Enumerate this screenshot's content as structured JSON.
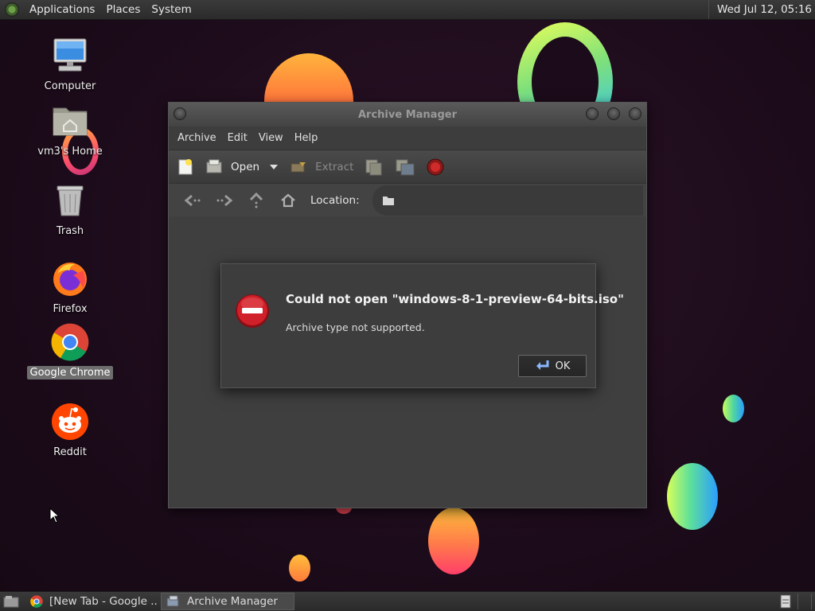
{
  "top_panel": {
    "menus": [
      "Applications",
      "Places",
      "System"
    ],
    "clock": "Wed Jul 12, 05:16"
  },
  "desktop": {
    "icons": [
      {
        "label": "Computer",
        "icon": "computer-icon"
      },
      {
        "label": "vm3's Home",
        "icon": "home-folder-icon"
      },
      {
        "label": "Trash",
        "icon": "trash-icon"
      },
      {
        "label": "Firefox",
        "icon": "firefox-icon"
      },
      {
        "label": "Google Chrome",
        "icon": "chrome-icon",
        "selected": true
      },
      {
        "label": "Reddit",
        "icon": "reddit-icon"
      }
    ]
  },
  "window": {
    "title": "Archive Manager",
    "menu": [
      "Archive",
      "Edit",
      "View",
      "Help"
    ],
    "toolbar": {
      "open_label": "Open",
      "extract_label": "Extract"
    },
    "location_label": "Location:"
  },
  "dialog": {
    "headline": "Could not open \"windows-8-1-preview-64-bits.iso\"",
    "message": "Archive type not supported.",
    "ok_label": "OK",
    "error_color": "#d0202a"
  },
  "taskbar": {
    "tasks": [
      {
        "label": "[New Tab - Google ...",
        "icon": "chrome-icon",
        "active": false
      },
      {
        "label": "Archive Manager",
        "icon": "archive-icon",
        "active": true
      }
    ]
  }
}
